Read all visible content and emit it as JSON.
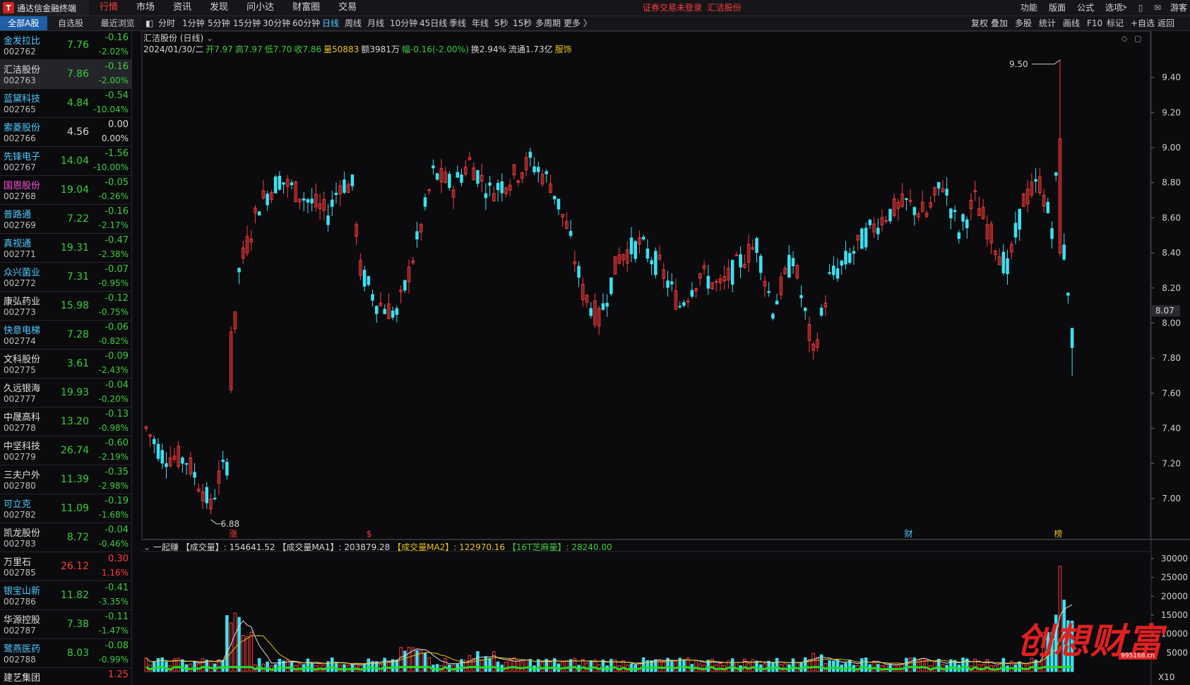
{
  "app": {
    "title": "通达信金融终端",
    "menu": [
      "行情",
      "市场",
      "资讯",
      "发现",
      "问小达",
      "财富圈",
      "交易"
    ],
    "active_menu": "行情",
    "notice": "证券交易未登录",
    "notice_stock": "汇洁股份",
    "right_menu": [
      "功能",
      "版面",
      "公式",
      "选项"
    ],
    "guest": "游客"
  },
  "left_tabs": [
    "全部A股",
    "自选股",
    "最近浏览"
  ],
  "stocks": [
    {
      "name": "金发拉比",
      "code": "002762",
      "price": "7.76",
      "change": "-0.16",
      "pct": "-2.02%",
      "dir": "dn",
      "nc": "n-blue"
    },
    {
      "name": "汇洁股份",
      "code": "002763",
      "price": "7.86",
      "change": "-0.16",
      "pct": "-2.00%",
      "dir": "dn",
      "nc": "n-white",
      "selected": true
    },
    {
      "name": "蓝黛科技",
      "code": "002765",
      "price": "4.84",
      "change": "-0.54",
      "pct": "-10.04%",
      "dir": "dn",
      "nc": "n-blue"
    },
    {
      "name": "索菱股份",
      "code": "002766",
      "price": "4.56",
      "change": "0.00",
      "pct": "0.00%",
      "dir": "flat",
      "nc": "n-blue"
    },
    {
      "name": "先锋电子",
      "code": "002767",
      "price": "14.04",
      "change": "-1.56",
      "pct": "-10.00%",
      "dir": "dn",
      "nc": "n-blue"
    },
    {
      "name": "国恩股份",
      "code": "002768",
      "price": "19.04",
      "change": "-0.05",
      "pct": "-0.26%",
      "dir": "dn",
      "nc": "n-pink"
    },
    {
      "name": "普路通",
      "code": "002769",
      "price": "7.22",
      "change": "-0.16",
      "pct": "-2.17%",
      "dir": "dn",
      "nc": "n-blue"
    },
    {
      "name": "真视通",
      "code": "002771",
      "price": "19.31",
      "change": "-0.47",
      "pct": "-2.38%",
      "dir": "dn",
      "nc": "n-blue"
    },
    {
      "name": "众兴菌业",
      "code": "002772",
      "price": "7.31",
      "change": "-0.07",
      "pct": "-0.95%",
      "dir": "dn",
      "nc": "n-blue"
    },
    {
      "name": "康弘药业",
      "code": "002773",
      "price": "15.98",
      "change": "-0.12",
      "pct": "-0.75%",
      "dir": "dn",
      "nc": "n-white"
    },
    {
      "name": "快意电梯",
      "code": "002774",
      "price": "7.28",
      "change": "-0.06",
      "pct": "-0.82%",
      "dir": "dn",
      "nc": "n-blue"
    },
    {
      "name": "文科股份",
      "code": "002775",
      "price": "3.61",
      "change": "-0.09",
      "pct": "-2.43%",
      "dir": "dn",
      "nc": "n-white"
    },
    {
      "name": "久远银海",
      "code": "002777",
      "price": "19.93",
      "change": "-0.04",
      "pct": "-0.20%",
      "dir": "dn",
      "nc": "n-white"
    },
    {
      "name": "中晟高科",
      "code": "002778",
      "price": "13.20",
      "change": "-0.13",
      "pct": "-0.98%",
      "dir": "dn",
      "nc": "n-white"
    },
    {
      "name": "中坚科技",
      "code": "002779",
      "price": "26.74",
      "change": "-0.60",
      "pct": "-2.19%",
      "dir": "dn",
      "nc": "n-white"
    },
    {
      "name": "三夫户外",
      "code": "002780",
      "price": "11.39",
      "change": "-0.35",
      "pct": "-2.98%",
      "dir": "dn",
      "nc": "n-white"
    },
    {
      "name": "可立克",
      "code": "002782",
      "price": "11.09",
      "change": "-0.19",
      "pct": "-1.68%",
      "dir": "dn",
      "nc": "n-blue"
    },
    {
      "name": "凯龙股份",
      "code": "002783",
      "price": "8.72",
      "change": "-0.04",
      "pct": "-0.46%",
      "dir": "dn",
      "nc": "n-white"
    },
    {
      "name": "万里石",
      "code": "002785",
      "price": "26.12",
      "change": "0.30",
      "pct": "1.16%",
      "dir": "up",
      "nc": "n-white"
    },
    {
      "name": "银宝山新",
      "code": "002786",
      "price": "11.82",
      "change": "-0.41",
      "pct": "-3.35%",
      "dir": "dn",
      "nc": "n-blue"
    },
    {
      "name": "华源控股",
      "code": "002787",
      "price": "7.38",
      "change": "-0.11",
      "pct": "-1.47%",
      "dir": "dn",
      "nc": "n-white"
    },
    {
      "name": "鹭燕医药",
      "code": "002788",
      "price": "8.03",
      "change": "-0.08",
      "pct": "-0.99%",
      "dir": "dn",
      "nc": "n-blue"
    },
    {
      "name": "建艺集团",
      "code": "",
      "price": "",
      "change": "1.25",
      "pct": "",
      "dir": "up",
      "nc": "n-white"
    }
  ],
  "periods": [
    "分时",
    "1分钟",
    "5分钟",
    "15分钟",
    "30分钟",
    "60分钟",
    "日线",
    "周线",
    "月线",
    "10分钟",
    "45日线",
    "季线",
    "年线",
    "5秒",
    "15秒",
    "多周期",
    "更多 〉"
  ],
  "active_period": "日线",
  "right_tools": [
    "复权",
    "叠加",
    "多股",
    "统计",
    "画线",
    "F10",
    "标记",
    "+自选",
    "返回"
  ],
  "chart": {
    "title": "汇洁股份 (日线)",
    "info": {
      "date": "2024/01/30/二",
      "open": "开7.97",
      "high": "高7.97",
      "low": "低7.70",
      "close": "收7.86",
      "vol": "量50883",
      "amount": "额3981万",
      "range": "幅-0.16(-2.00%)",
      "turnover": "换2.94%",
      "float": "流通1.73亿",
      "industry": "服饰"
    },
    "price_labels": [
      "9.40",
      "9.20",
      "9.00",
      "8.80",
      "8.60",
      "8.40",
      "8.20",
      "8.00",
      "7.80",
      "7.60",
      "7.40",
      "7.20",
      "7.00"
    ],
    "price_values": [
      9.4,
      9.2,
      9.0,
      8.8,
      8.6,
      8.4,
      8.2,
      8.0,
      7.8,
      7.6,
      7.4,
      7.2,
      7.0
    ],
    "current_price": "8.07",
    "max_label": "9.50",
    "min_label": "6.88",
    "markers": [
      "涨",
      "$",
      "财",
      "榜"
    ],
    "vol_indicator": "一起赚",
    "vol_fields": [
      "【成交量】: 154641.52",
      "【成交量MA1】: 203879.28",
      "【成交量MA2】: 122970.16",
      "【16T芝麻量】: 28240.00"
    ],
    "vol_labels": [
      "30000",
      "25000",
      "20000",
      "15000",
      "10000",
      "5000",
      "X10"
    ],
    "vol_values": [
      30000,
      25000,
      20000,
      15000,
      10000,
      5000
    ]
  },
  "watermark": {
    "text": "创想财富",
    "url": "995168.cn"
  },
  "colors": {
    "up": "#ff3b3b",
    "down": "#3fe0f0",
    "ma1": "#e0e0e0",
    "ma2": "#e8c21a",
    "ma3": "#22dd22",
    "accent": "#1e5fa8"
  }
}
